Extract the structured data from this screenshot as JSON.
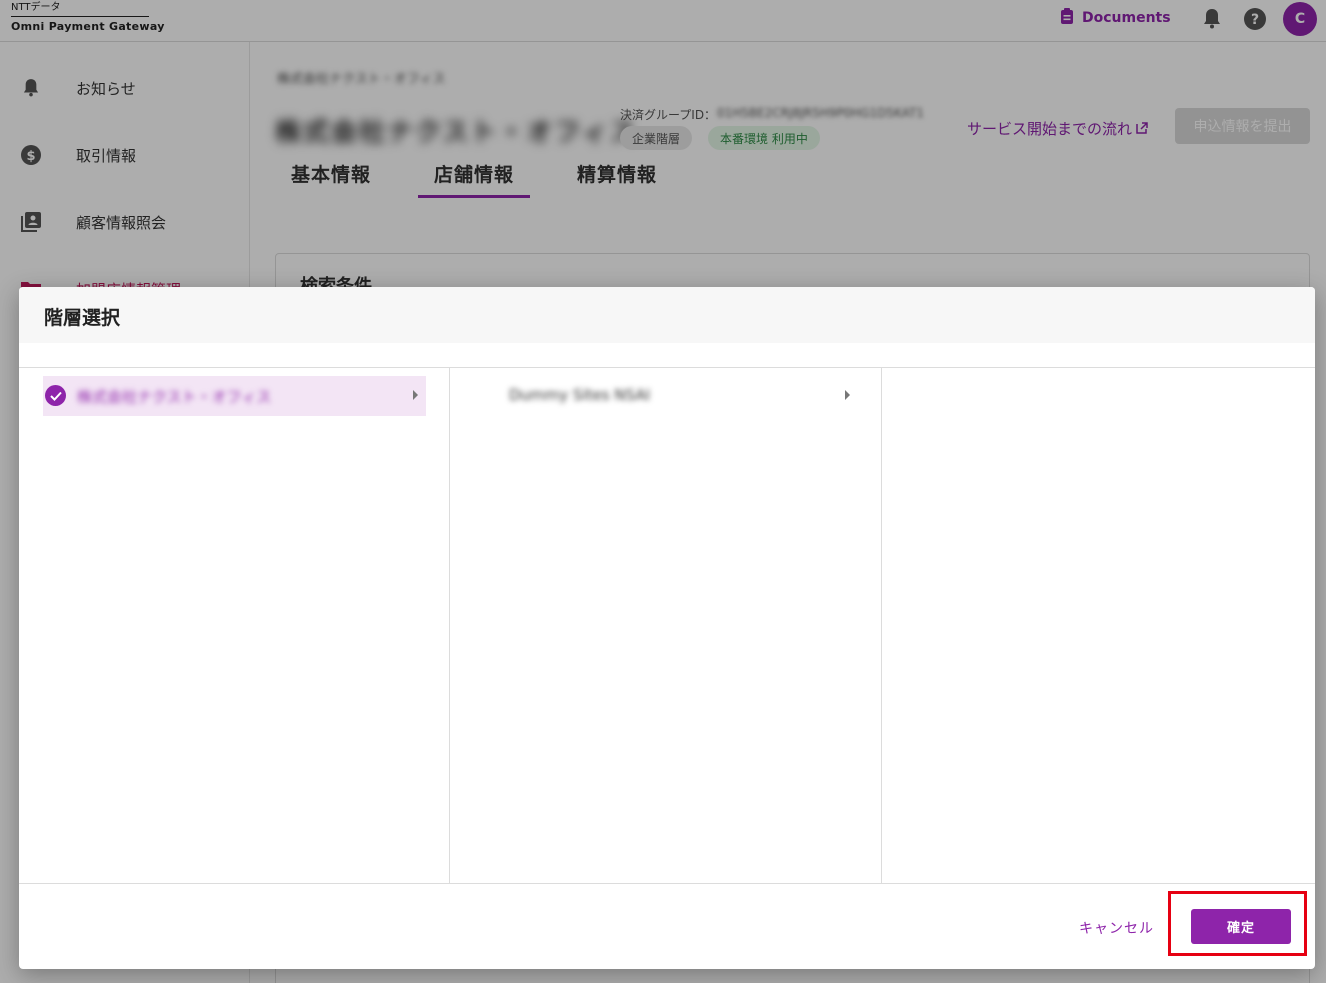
{
  "header": {
    "logo_top": "NTTデータ",
    "logo_bottom": "Omni Payment Gateway",
    "documents_label": "Documents",
    "avatar_initial": "C"
  },
  "sidebar": {
    "items": [
      {
        "label": "お知らせ",
        "icon": "bell-icon"
      },
      {
        "label": "取引情報",
        "icon": "dollar-icon"
      },
      {
        "label": "顧客情報照会",
        "icon": "contacts-icon"
      },
      {
        "label": "加盟店情報管理",
        "icon": "folder-icon"
      }
    ]
  },
  "main": {
    "company_small": "株式会社ナクスト・オフィス",
    "company_name": "株式会社ナクスト・オフィス",
    "group_id_label": "決済グループID：",
    "group_id_value": "01H5BE2CRJ8JR5H9P0HG1D5KAT1",
    "chip_hierarchy": "企業階層",
    "chip_env": "本番環境 利用中",
    "flow_link": "サービス開始までの流れ",
    "submit_button": "申込情報を提出",
    "tabs": [
      {
        "label": "基本情報"
      },
      {
        "label": "店舗情報"
      },
      {
        "label": "精算情報"
      }
    ],
    "active_tab": "店舗情報",
    "search_title": "検索条件"
  },
  "dialog": {
    "title": "階層選択",
    "column1_item": "株式会社ナクスト・オフィス",
    "column2_item": "Dummy Sites NSAI",
    "cancel_label": "キャンセル",
    "confirm_label": "確定"
  },
  "colors": {
    "accent": "#8e24aa",
    "highlight_border": "#e60012",
    "selected_bg": "#f3e5f5"
  }
}
